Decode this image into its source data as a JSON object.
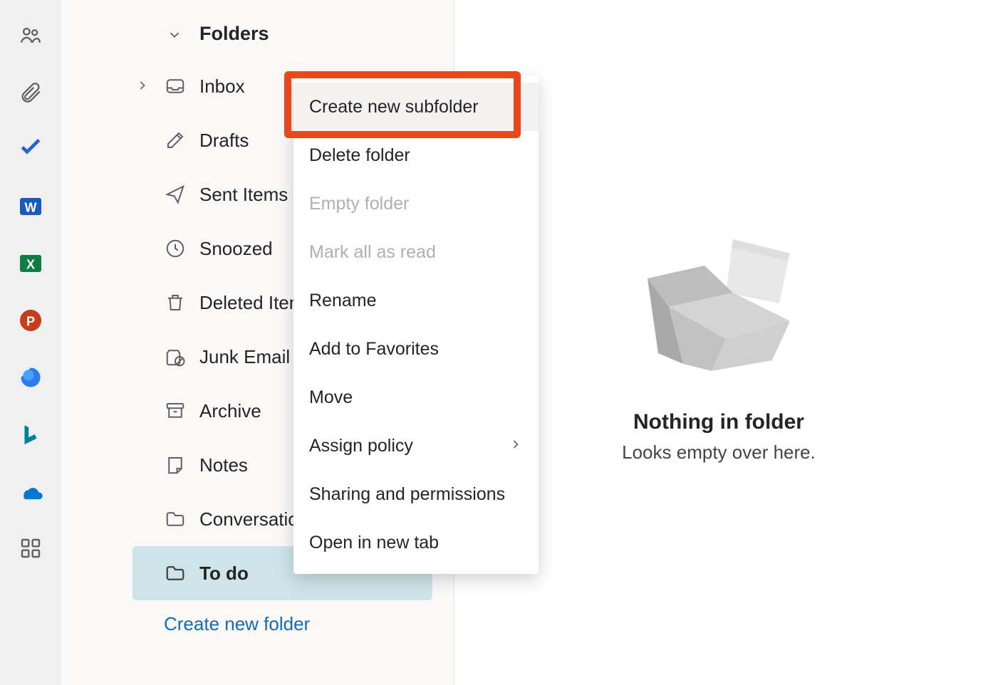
{
  "app_rail": {
    "items": [
      {
        "name": "people-icon",
        "color": "#616161"
      },
      {
        "name": "attach-icon",
        "color": "#616161"
      },
      {
        "name": "todo-icon",
        "color": "#2564cf"
      },
      {
        "name": "word-icon",
        "color": "#185abd"
      },
      {
        "name": "excel-icon",
        "color": "#107c41"
      },
      {
        "name": "powerpoint-icon",
        "color": "#c43e1c"
      },
      {
        "name": "viva-icon",
        "color": "#2a7ded"
      },
      {
        "name": "bing-icon",
        "color": "#00809d"
      },
      {
        "name": "onedrive-icon",
        "color": "#0078d4"
      },
      {
        "name": "apps-icon",
        "color": "#616161"
      }
    ]
  },
  "folders": {
    "header": "Folders",
    "items": [
      {
        "label": "Inbox",
        "icon": "inbox-icon",
        "expandable": true
      },
      {
        "label": "Drafts",
        "icon": "drafts-icon"
      },
      {
        "label": "Sent Items",
        "icon": "sent-icon"
      },
      {
        "label": "Snoozed",
        "icon": "snoozed-icon"
      },
      {
        "label": "Deleted Items",
        "icon": "deleted-icon"
      },
      {
        "label": "Junk Email",
        "icon": "junk-icon"
      },
      {
        "label": "Archive",
        "icon": "archive-icon"
      },
      {
        "label": "Notes",
        "icon": "notes-icon"
      },
      {
        "label": "Conversation History",
        "icon": "folder-icon"
      },
      {
        "label": "To do",
        "icon": "folder-icon",
        "selected": true
      }
    ],
    "create_label": "Create new folder"
  },
  "context_menu": {
    "items": [
      {
        "label": "Create new subfolder",
        "hovered": true
      },
      {
        "label": "Delete folder"
      },
      {
        "label": "Empty folder",
        "disabled": true
      },
      {
        "label": "Mark all as read",
        "disabled": true
      },
      {
        "label": "Rename"
      },
      {
        "label": "Add to Favorites"
      },
      {
        "label": "Move"
      },
      {
        "label": "Assign policy",
        "submenu": true
      },
      {
        "label": "Sharing and permissions"
      },
      {
        "label": "Open in new tab"
      }
    ]
  },
  "empty_state": {
    "title": "Nothing in folder",
    "subtitle": "Looks empty over here."
  },
  "highlight": {
    "target": "Create new subfolder",
    "color": "#e8481c"
  }
}
